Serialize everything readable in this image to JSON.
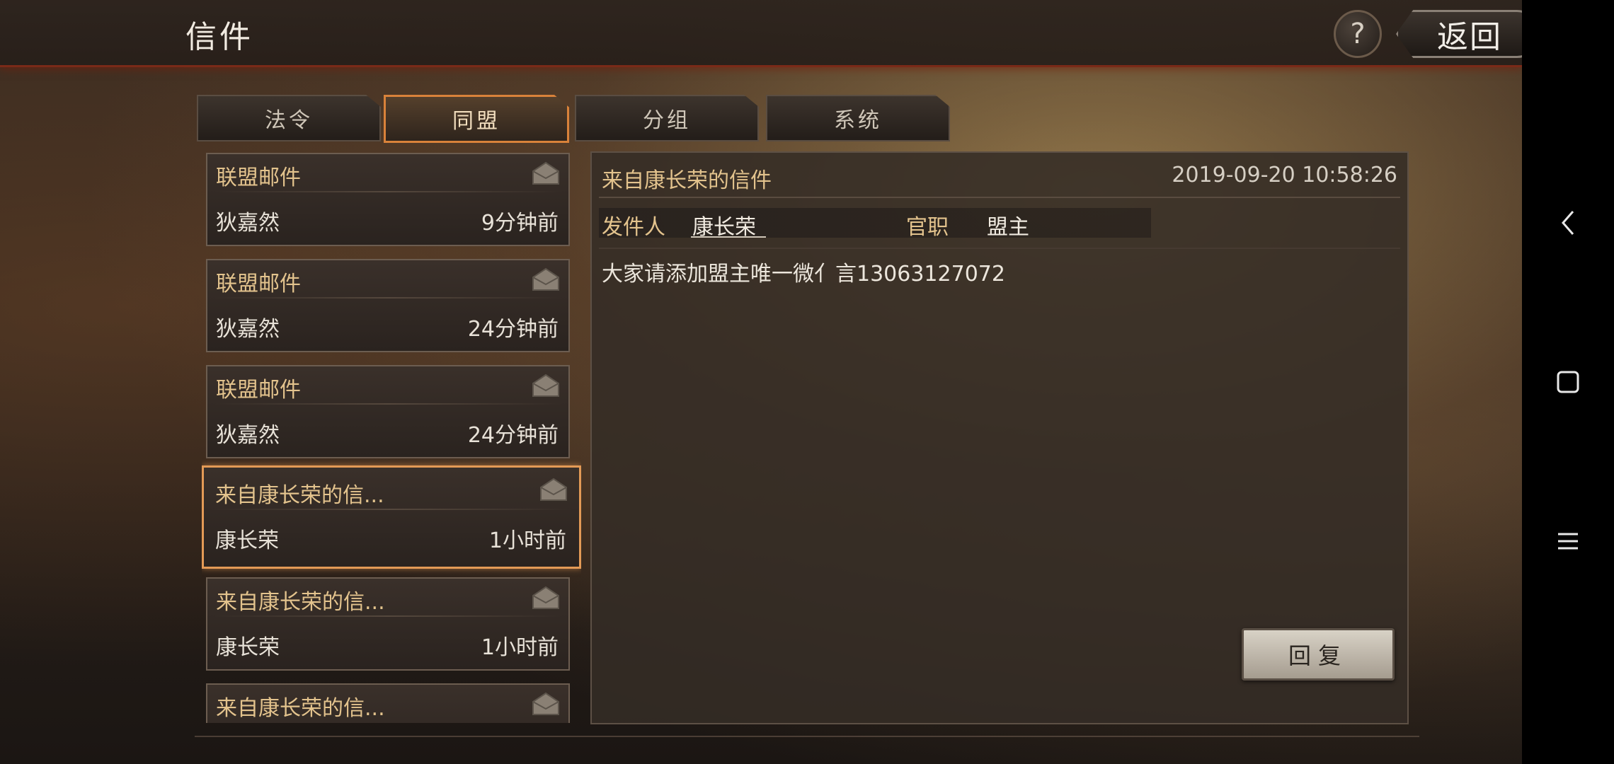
{
  "header": {
    "title": "信件",
    "help_label": "?",
    "back_label": "返回"
  },
  "tabs": [
    {
      "label": "法令",
      "active": false
    },
    {
      "label": "同盟",
      "active": true
    },
    {
      "label": "分组",
      "active": false
    },
    {
      "label": "系统",
      "active": false
    }
  ],
  "mail_list": [
    {
      "subject": "联盟邮件",
      "sender": "狄嘉然",
      "time": "9分钟前",
      "selected": false
    },
    {
      "subject": "联盟邮件",
      "sender": "狄嘉然",
      "time": "24分钟前",
      "selected": false
    },
    {
      "subject": "联盟邮件",
      "sender": "狄嘉然",
      "time": "24分钟前",
      "selected": false
    },
    {
      "subject": "来自康长荣的信...",
      "sender": "康长荣",
      "time": "1小时前",
      "selected": true
    },
    {
      "subject": "来自康长荣的信...",
      "sender": "康长荣",
      "time": "1小时前",
      "selected": false
    },
    {
      "subject": "来自康长荣的信...",
      "sender": "",
      "time": "",
      "selected": false
    }
  ],
  "detail": {
    "title": "来自康长荣的信件",
    "date": "2019-09-20 10:58:26",
    "sender_label": "发件人",
    "sender_value": "康长荣",
    "position_label": "官职",
    "position_value": "盟主",
    "body": "大家请添加盟主唯一微亻言13063127072",
    "reply_label": "回复"
  },
  "colors": {
    "accent": "#e39a56",
    "gold_text": "#e3c38d"
  }
}
